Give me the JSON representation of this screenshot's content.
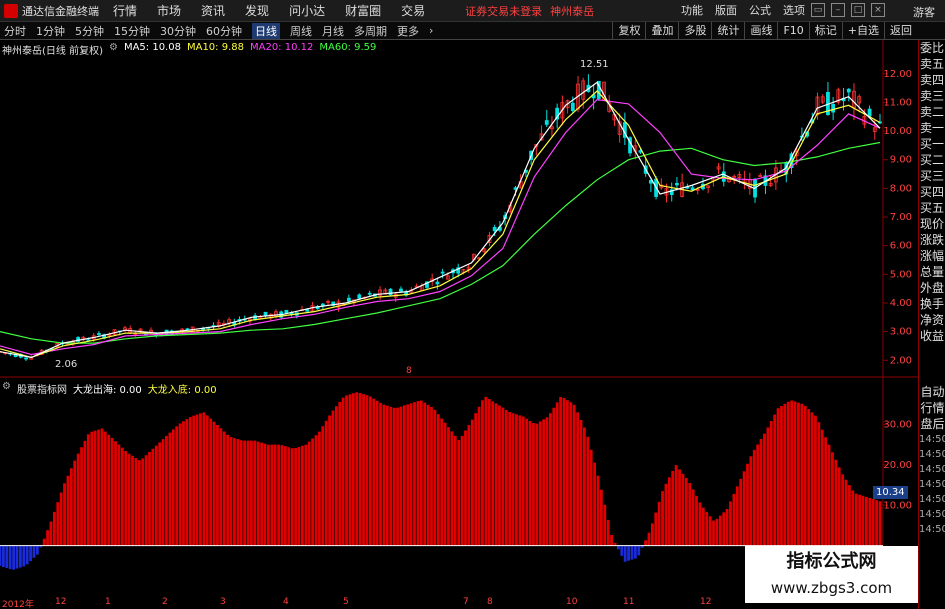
{
  "app": {
    "title": "通达信金融终端"
  },
  "menu": [
    "行情",
    "市场",
    "资讯",
    "发现",
    "问小达",
    "财富圈",
    "交易"
  ],
  "login_status": "证券交易未登录",
  "stock_top": "神州泰岳",
  "right_menu": [
    "功能",
    "版面",
    "公式",
    "选项",
    "游客"
  ],
  "periods": [
    "分时",
    "1分钟",
    "5分钟",
    "15分钟",
    "30分钟",
    "60分钟",
    "日线",
    "周线",
    "月线",
    "多周期",
    "更多"
  ],
  "active_period": "日线",
  "tool_buttons": [
    "复权",
    "叠加",
    "多股",
    "统计",
    "画线",
    "F10",
    "标记",
    "+自选",
    "返回"
  ],
  "legend": {
    "stock": "神州泰岳(日线 前复权)",
    "ma5": "MA5: 10.08",
    "ma10": "MA10: 9.88",
    "ma20": "MA20: 10.12",
    "ma60": "MA60: 9.59"
  },
  "indicator_legend": {
    "name": "股票指标网",
    "l1": "大龙出海: 0.00",
    "l2": "大龙入底: 0.00"
  },
  "colors": {
    "up": "#ff3030",
    "down": "#00e0e0",
    "ma5": "#ffffff",
    "ma10": "#ffff40",
    "ma20": "#ff40ff",
    "ma60": "#40ff40",
    "bar_pos": "#e00000",
    "bar_neg": "#1a2bd8"
  },
  "side_panel": [
    "委比",
    "卖五",
    "卖四",
    "卖三",
    "卖二",
    "卖一",
    "买一",
    "买二",
    "买三",
    "买四",
    "买五",
    "现价",
    "涨跌",
    "涨幅",
    "总量",
    "外盘",
    "换手",
    "净资",
    "收益"
  ],
  "side_panel2": [
    "自动",
    "行情",
    "盘后"
  ],
  "side_times": [
    "14:50",
    "14:50",
    "14:50",
    "14:50",
    "14:50",
    "14:50",
    "14:50"
  ],
  "price_axis": [
    "12.00",
    "11.00",
    "10.00",
    "9.00",
    "8.00",
    "7.00",
    "6.00",
    "5.00",
    "4.00",
    "3.00",
    "2.00"
  ],
  "ind_axis": [
    "30.00",
    "20.00",
    "10.00"
  ],
  "current_value": "10.34",
  "high_label": "12.51",
  "low_label": "2.06",
  "date_axis": [
    "2012年",
    "12",
    "1",
    "2",
    "3",
    "4",
    "5",
    "7",
    "8",
    "10",
    "11",
    "12"
  ],
  "watermark": {
    "title": "指标公式网",
    "url": "www.zbgs3.com"
  },
  "chart_data": [
    {
      "type": "line",
      "title": "神州泰岳(日线 前复权)",
      "ylim": [
        1.8,
        12.9
      ],
      "series": [
        {
          "name": "MA60",
          "values": [
            3.0,
            2.75,
            2.6,
            2.6,
            2.75,
            2.85,
            2.9,
            2.95,
            3.05,
            3.1,
            3.25,
            3.45,
            3.65,
            3.9,
            4.15,
            4.65,
            5.3,
            6.4,
            7.4,
            8.3,
            9.0,
            9.3,
            9.4,
            9.0,
            8.8,
            8.9,
            9.1,
            9.4,
            9.6
          ]
        },
        {
          "name": "MA20",
          "values": [
            2.5,
            2.2,
            2.4,
            2.55,
            2.85,
            2.9,
            2.95,
            3.0,
            3.25,
            3.45,
            3.6,
            3.85,
            4.05,
            4.15,
            4.4,
            4.95,
            5.9,
            8.4,
            9.95,
            11.1,
            10.95,
            9.95,
            8.5,
            8.35,
            8.3,
            8.6,
            9.5,
            10.6,
            10.1
          ]
        },
        {
          "name": "MA10",
          "values": [
            2.4,
            2.1,
            2.5,
            2.7,
            2.95,
            2.95,
            3.0,
            3.1,
            3.4,
            3.55,
            3.7,
            3.95,
            4.2,
            4.3,
            4.6,
            5.2,
            6.4,
            9.0,
            10.4,
            11.4,
            10.2,
            8.1,
            7.9,
            8.4,
            8.1,
            8.5,
            10.6,
            10.9,
            10.3
          ]
        },
        {
          "name": "MA5",
          "values": [
            2.3,
            2.1,
            2.6,
            2.8,
            3.05,
            2.95,
            3.05,
            3.2,
            3.5,
            3.6,
            3.85,
            4.0,
            4.3,
            4.4,
            4.9,
            5.4,
            6.8,
            9.4,
            10.9,
            11.7,
            9.7,
            7.8,
            8.1,
            8.5,
            8.0,
            8.7,
            10.8,
            11.2,
            10.1
          ]
        }
      ]
    },
    {
      "type": "bar",
      "title": "股票指标网",
      "ylim": [
        -8,
        40
      ],
      "values": [
        -5,
        -6,
        -5,
        -2,
        6,
        15,
        22,
        28,
        29,
        26,
        23,
        21,
        24,
        27,
        30,
        32,
        33,
        30,
        27,
        26,
        26,
        25,
        25,
        24,
        25,
        28,
        33,
        37,
        38,
        37,
        35,
        34,
        35,
        36,
        34,
        30,
        26,
        31,
        37,
        35,
        33,
        32,
        30,
        32,
        37,
        35,
        28,
        16,
        2,
        -4,
        -3,
        4,
        14,
        20,
        16,
        10,
        6,
        9,
        16,
        23,
        28,
        34,
        36,
        35,
        32,
        25,
        18,
        13,
        12,
        11
      ]
    }
  ]
}
